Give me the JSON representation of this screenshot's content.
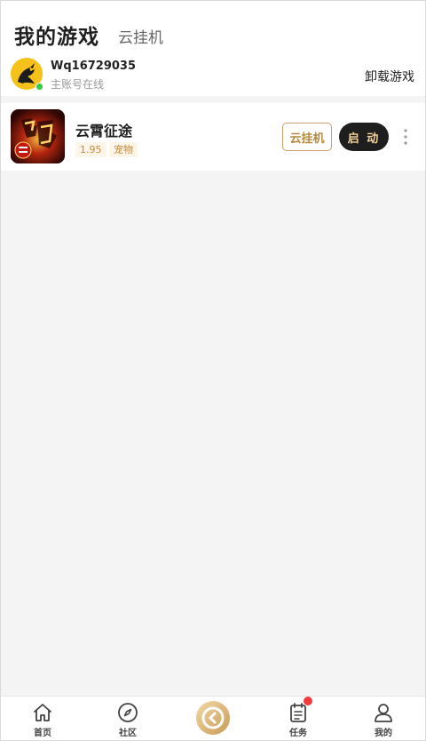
{
  "header": {
    "tab_my_games": "我的游戏",
    "tab_cloud_hosting": "云挂机"
  },
  "account": {
    "username": "Wq16729035",
    "status": "主账号在线",
    "online_color": "#2ecc40",
    "uninstall_label": "卸载游戏"
  },
  "games": [
    {
      "title": "云霄征途",
      "version": "1.95",
      "category": "宠物",
      "cloud_button": "云挂机",
      "start_button": "启 动"
    }
  ],
  "nav": {
    "home": "首页",
    "community": "社区",
    "tasks": "任务",
    "me": "我的",
    "tasks_has_badge": true
  },
  "colors": {
    "accent_gold": "#c9a06b",
    "start_bg": "#1e1e1e",
    "badge_red": "#f23c3c"
  },
  "icons": {
    "avatar": "dragon-avatar-icon",
    "game": "game-cover-icon",
    "more": "more-vertical-icon",
    "home": "home-icon",
    "community": "compass-icon",
    "center": "brand-logo-icon",
    "tasks": "clipboard-icon",
    "me": "user-icon"
  }
}
